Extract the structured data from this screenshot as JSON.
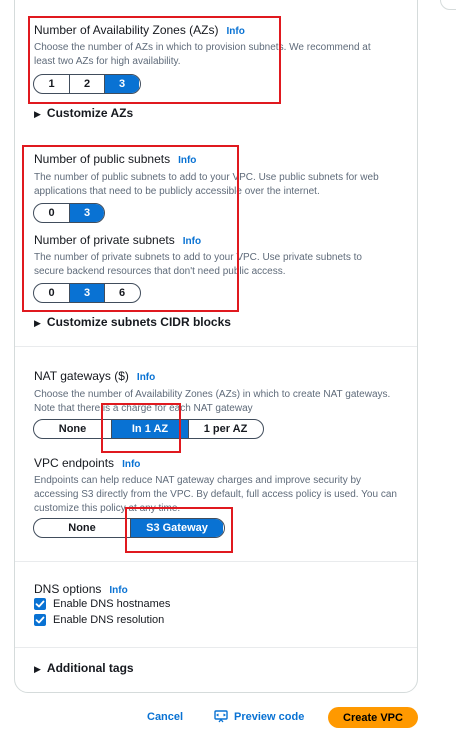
{
  "azs": {
    "label": "Number of Availability Zones (AZs)",
    "info": "Info",
    "description": "Choose the number of AZs in which to provision subnets. We recommend at least two AZs for high availability.",
    "options": [
      "1",
      "2",
      "3"
    ],
    "selected": "3",
    "customize": "Customize AZs"
  },
  "public_subnets": {
    "label": "Number of public subnets",
    "info": "Info",
    "description": "The number of public subnets to add to your VPC. Use public subnets for web applications that need to be publicly accessible over the internet.",
    "options": [
      "0",
      "3"
    ],
    "selected": "3"
  },
  "private_subnets": {
    "label": "Number of private subnets",
    "info": "Info",
    "description": "The number of private subnets to add to your VPC. Use private subnets to secure backend resources that don't need public access.",
    "options": [
      "0",
      "3",
      "6"
    ],
    "selected": "3",
    "customize": "Customize subnets CIDR blocks"
  },
  "nat": {
    "label": "NAT gateways ($)",
    "info": "Info",
    "description": "Choose the number of Availability Zones (AZs) in which to create NAT gateways. Note that there is a charge for each NAT gateway",
    "options": [
      "None",
      "In 1 AZ",
      "1 per AZ"
    ],
    "selected": "In 1 AZ"
  },
  "endpoints": {
    "label": "VPC endpoints",
    "info": "Info",
    "description": "Endpoints can help reduce NAT gateway charges and improve security by accessing S3 directly from the VPC. By default, full access policy is used. You can customize this policy at any time.",
    "options": [
      "None",
      "S3 Gateway"
    ],
    "selected": "S3 Gateway"
  },
  "dns": {
    "label": "DNS options",
    "info": "Info",
    "hostnames": "Enable DNS hostnames",
    "resolution": "Enable DNS resolution",
    "hostnames_checked": true,
    "resolution_checked": true
  },
  "tags": {
    "label": "Additional tags"
  },
  "footer": {
    "cancel": "Cancel",
    "preview": "Preview code",
    "create": "Create VPC"
  },
  "colors": {
    "accent": "#0972d3",
    "primary": "#ff9900",
    "highlight": "#e0191f"
  }
}
